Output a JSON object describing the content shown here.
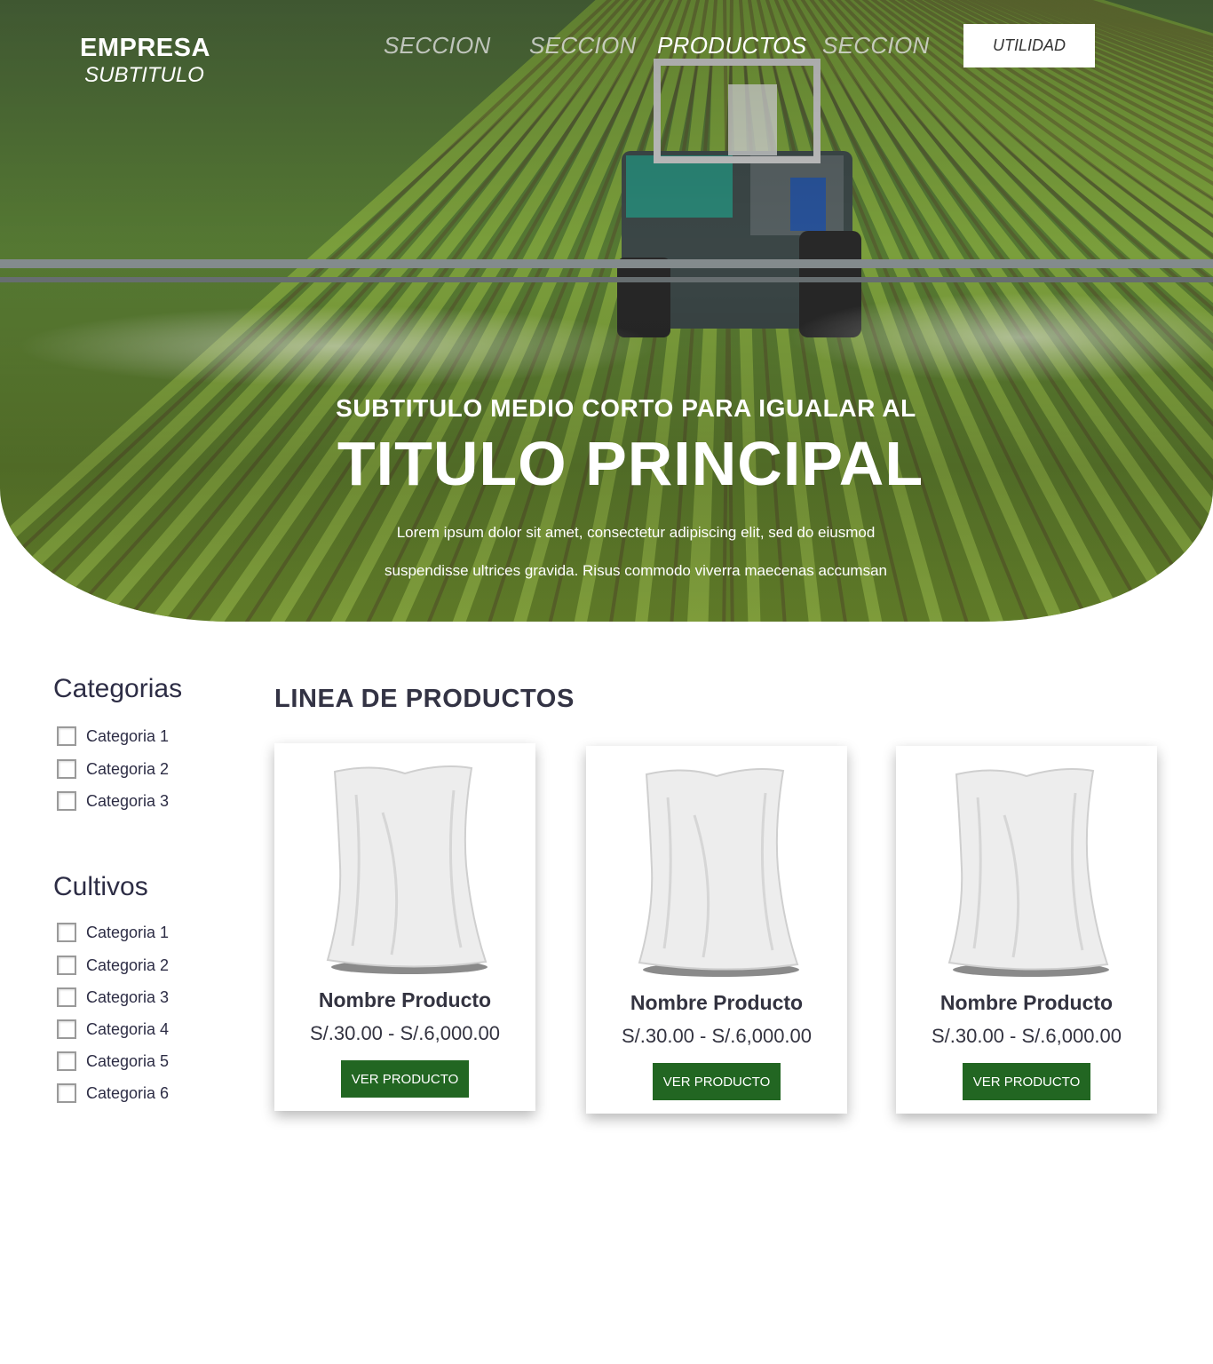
{
  "brand": {
    "name": "EMPRESA",
    "subtitle": "SUBTITULO"
  },
  "nav": {
    "links": [
      {
        "label": "SECCION",
        "active": false
      },
      {
        "label": "SECCION",
        "active": false
      },
      {
        "label": "PRODUCTOS",
        "active": true
      },
      {
        "label": "SECCION",
        "active": false
      }
    ],
    "utility_button": "UTILIDAD"
  },
  "hero": {
    "kicker": "SUBTITULO MEDIO CORTO PARA IGUALAR AL",
    "title": "TITULO PRINCIPAL",
    "description_line1": "Lorem ipsum dolor sit amet, consectetur adipiscing elit, sed do eiusmod",
    "description_line2": "suspendisse ultrices gravida. Risus commodo viverra maecenas accumsan"
  },
  "filters": {
    "categorias": {
      "title": "Categorias",
      "items": [
        "Categoria 1",
        "Categoria 2",
        "Categoria 3"
      ]
    },
    "cultivos": {
      "title": "Cultivos",
      "items": [
        "Categoria 1",
        "Categoria 2",
        "Categoria 3",
        "Categoria 4",
        "Categoria 5",
        "Categoria 6"
      ]
    }
  },
  "products": {
    "section_title": "LINEA DE PRODUCTOS",
    "items": [
      {
        "name": "Nombre Producto",
        "price": "S/.30.00 - S/.6,000.00",
        "button": "VER PRODUCTO"
      },
      {
        "name": "Nombre Producto",
        "price": "S/.30.00 - S/.6,000.00",
        "button": "VER PRODUCTO"
      },
      {
        "name": "Nombre Producto",
        "price": "S/.30.00 - S/.6,000.00",
        "button": "VER PRODUCTO"
      }
    ]
  },
  "colors": {
    "accent_green": "#226622",
    "text_dark": "#2d2d45"
  }
}
